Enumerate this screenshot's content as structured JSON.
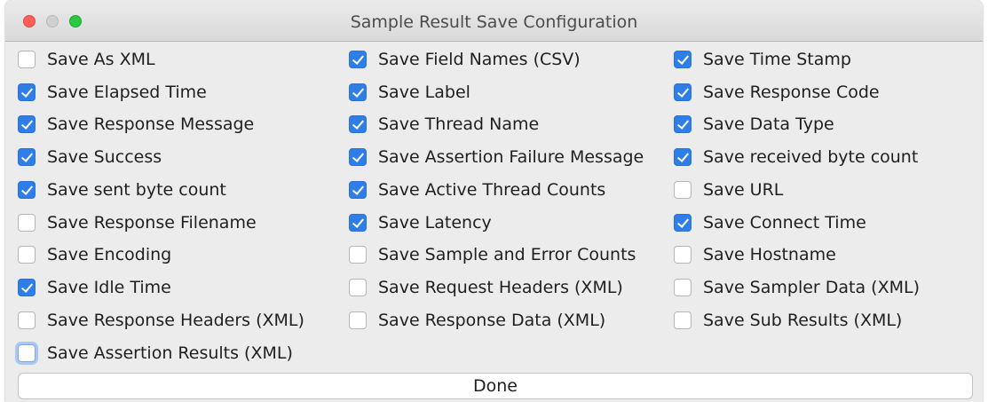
{
  "window": {
    "title": "Sample Result Save Configuration"
  },
  "options": {
    "col1": [
      {
        "label": "Save As XML",
        "checked": false
      },
      {
        "label": "Save Elapsed Time",
        "checked": true
      },
      {
        "label": "Save Response Message",
        "checked": true
      },
      {
        "label": "Save Success",
        "checked": true
      },
      {
        "label": "Save sent byte count",
        "checked": true
      },
      {
        "label": "Save Response Filename",
        "checked": false
      },
      {
        "label": "Save Encoding",
        "checked": false
      },
      {
        "label": "Save Idle Time",
        "checked": true
      },
      {
        "label": "Save Response Headers (XML)",
        "checked": false
      },
      {
        "label": "Save Assertion Results (XML)",
        "checked": false,
        "focused": true
      }
    ],
    "col2": [
      {
        "label": "Save Field Names (CSV)",
        "checked": true
      },
      {
        "label": "Save Label",
        "checked": true
      },
      {
        "label": "Save Thread Name",
        "checked": true
      },
      {
        "label": "Save Assertion Failure Message",
        "checked": true
      },
      {
        "label": "Save Active Thread Counts",
        "checked": true
      },
      {
        "label": "Save Latency",
        "checked": true
      },
      {
        "label": "Save Sample and Error Counts",
        "checked": false
      },
      {
        "label": "Save Request Headers (XML)",
        "checked": false
      },
      {
        "label": "Save Response Data (XML)",
        "checked": false
      }
    ],
    "col3": [
      {
        "label": "Save Time Stamp",
        "checked": true
      },
      {
        "label": "Save Response Code",
        "checked": true
      },
      {
        "label": "Save Data Type",
        "checked": true
      },
      {
        "label": "Save received byte count",
        "checked": true
      },
      {
        "label": "Save URL",
        "checked": false
      },
      {
        "label": "Save Connect Time",
        "checked": true
      },
      {
        "label": "Save Hostname",
        "checked": false
      },
      {
        "label": "Save Sampler Data (XML)",
        "checked": false
      },
      {
        "label": "Save Sub Results (XML)",
        "checked": false
      }
    ]
  },
  "footer": {
    "done_label": "Done"
  },
  "colors": {
    "checkbox_checked": "#2f7ee8",
    "close_button": "#fc5f57",
    "zoom_button": "#2ac940"
  }
}
